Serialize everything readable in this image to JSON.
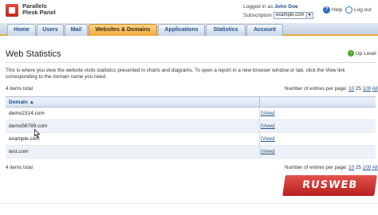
{
  "header": {
    "brand_line1": "Parallels",
    "brand_line2": "Plesk Panel",
    "logged_in_as_label": "Logged in as",
    "user_name": "John Doe",
    "subscription_label": "Subscription",
    "subscription_value": "example.com",
    "help_label": "Help",
    "logout_label": "Log out"
  },
  "tabs": [
    {
      "label": "Home"
    },
    {
      "label": "Users"
    },
    {
      "label": "Mail"
    },
    {
      "label": "Websites & Domains",
      "active": true
    },
    {
      "label": "Applications"
    },
    {
      "label": "Statistics"
    },
    {
      "label": "Account"
    }
  ],
  "page": {
    "title": "Web Statistics",
    "up_level": "Up Level",
    "description": "This is where you view the website visits statistics presented in charts and diagrams. To open a report in a new browser window or tab, click the View link corresponding to the domain name you need."
  },
  "list": {
    "items_total": "4 items total",
    "entries_label": "Number of entries per page:",
    "page_sizes": [
      "10",
      "25",
      "100",
      "All"
    ],
    "column_domain": "Domain",
    "sort_indicator": "▲",
    "rows": [
      {
        "domain": "demo2314.com",
        "action": "[View]"
      },
      {
        "domain": "demo56789.com",
        "action": "[View]"
      },
      {
        "domain": "example.com",
        "action": "[View]"
      },
      {
        "domain": "test.com",
        "action": "[View]"
      }
    ]
  },
  "watermark": "RUSWEB",
  "colors": {
    "accent_tab": "#f2a93a",
    "link": "#1f4f8a",
    "tab_bar": "#c3d2e4"
  }
}
